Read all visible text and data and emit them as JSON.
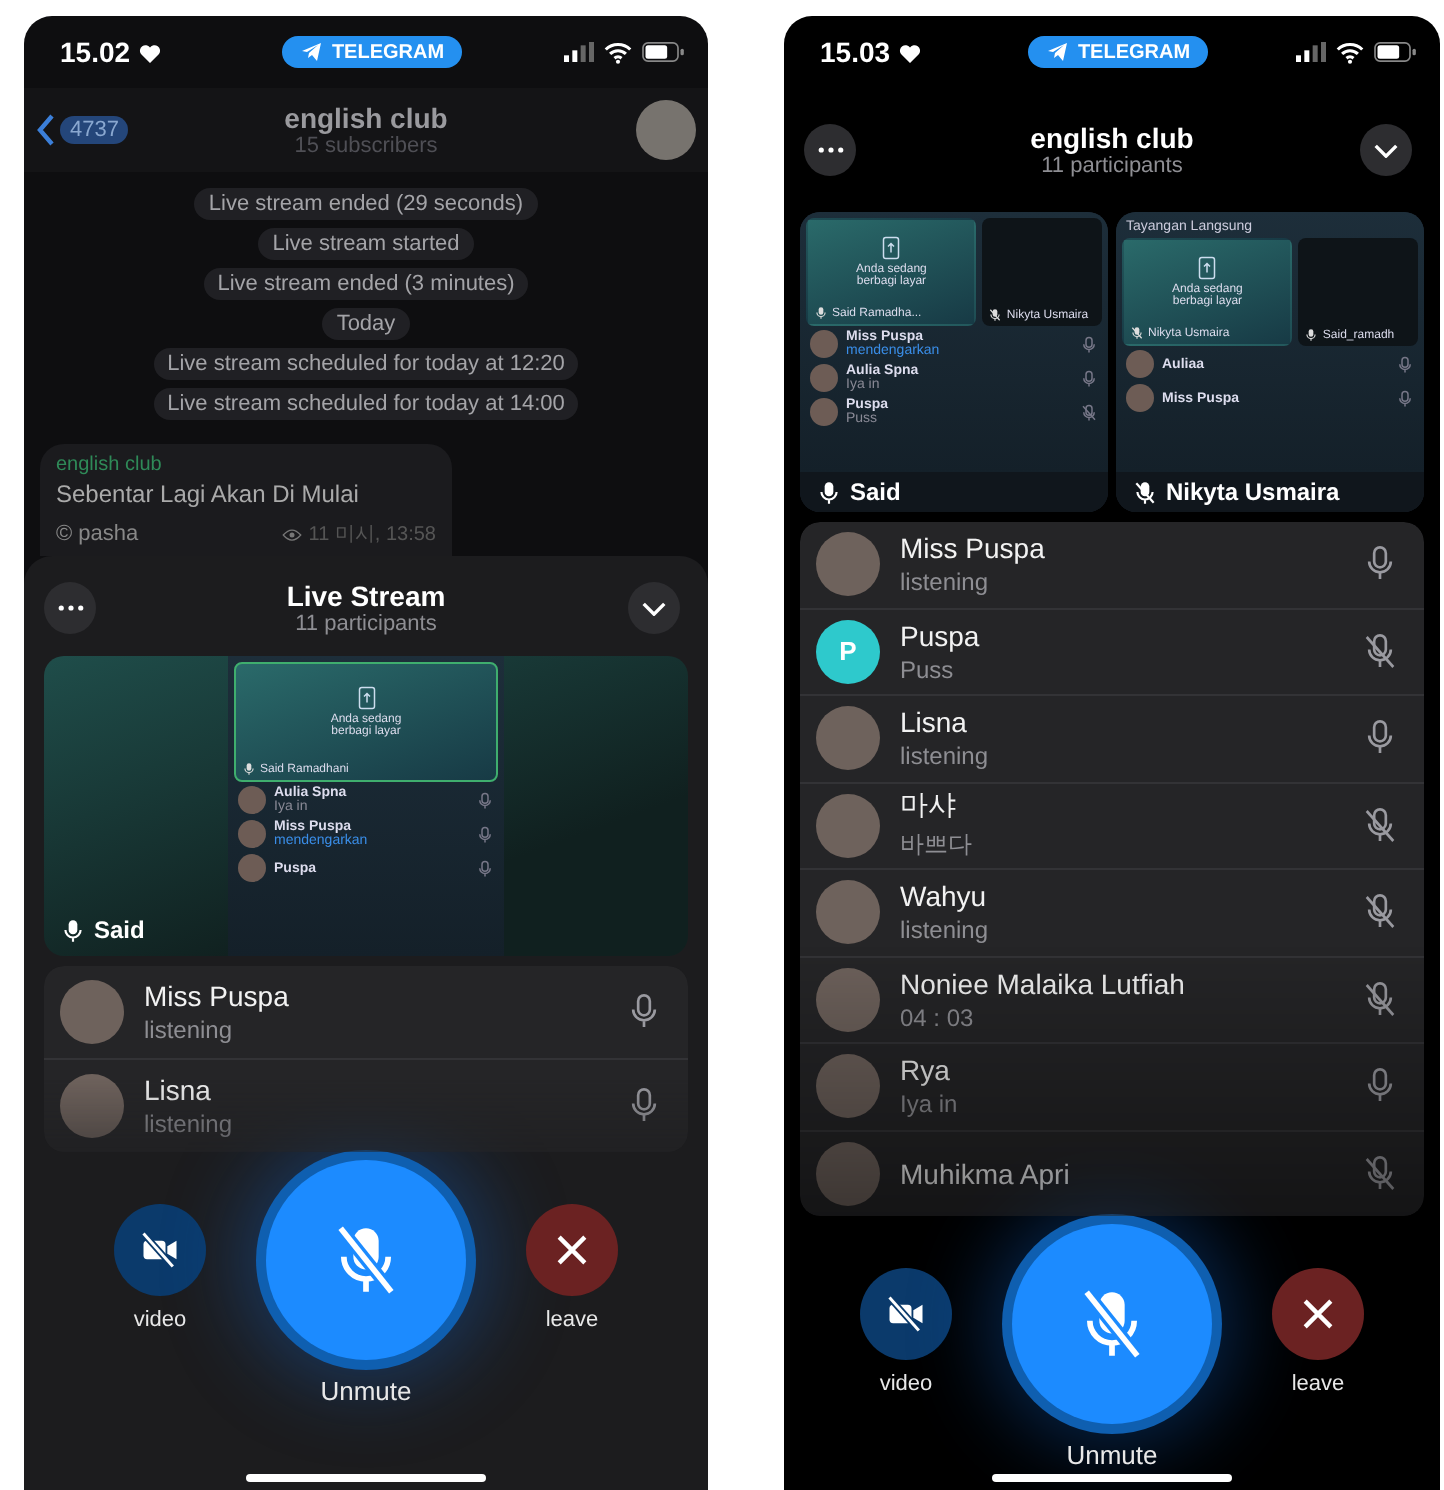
{
  "screens": [
    {
      "kind": "panel",
      "status_bar": {
        "time": "15.02",
        "app_pill": "TELEGRAM"
      },
      "chat": {
        "back_badge": "4737",
        "title": "english club",
        "subtitle": "15 subscribers",
        "service_messages": [
          "Live stream ended (29 seconds)",
          "Live stream started",
          "Live stream ended (3 minutes)",
          "Today",
          "Live stream scheduled for today at 12:20",
          "Live stream scheduled for today at 14:00"
        ],
        "post": {
          "author": "english club",
          "text": "Sebentar Lagi Akan Di Mulai",
          "signature": "© pasha",
          "meta": "11 미시, 13:58"
        }
      },
      "call": {
        "title": "Live Stream",
        "subtitle": "11 participants",
        "tiles": [
          {
            "kind": "centered",
            "label": "Said",
            "muted": false,
            "screen": {
              "cards": [
                {
                  "notice": "Anda sedang berbagi layar",
                  "name": "Said Ramadhani",
                  "muted": false
                }
              ],
              "rows": [
                {
                  "name": "Aulia Spna",
                  "status": "Iya in",
                  "highlighted": false,
                  "muted": false
                },
                {
                  "name": "Miss Puspa",
                  "status": "mendengarkan",
                  "highlighted": true,
                  "muted": false
                },
                {
                  "name": "Puspa",
                  "muted": false
                }
              ]
            }
          }
        ],
        "participants": [
          {
            "name": "Miss Puspa",
            "status": "listening",
            "muted": false,
            "avatar": {
              "kind": "photo"
            }
          },
          {
            "name": "Lisna",
            "status": "listening",
            "muted": false,
            "avatar": {
              "kind": "photo"
            }
          }
        ],
        "controls": [
          {
            "kind": "video",
            "label": "video"
          },
          {
            "kind": "mute",
            "label": "Unmute"
          },
          {
            "kind": "leave",
            "label": "leave"
          }
        ]
      }
    },
    {
      "kind": "fullscreen",
      "status_bar": {
        "time": "15.03",
        "app_pill": "TELEGRAM"
      },
      "call": {
        "title": "english club",
        "subtitle": "11 participants",
        "tiles": [
          {
            "kind": "fill",
            "label": "Said",
            "muted": false,
            "screen": {
              "cards": [
                {
                  "notice": "Anda sedang berbagi layar",
                  "name": "Said Ramadha...",
                  "muted": false
                },
                {
                  "name": "Nikyta Usmaira",
                  "muted": true
                }
              ],
              "rows": [
                {
                  "name": "Miss Puspa",
                  "status": "mendengarkan",
                  "highlighted": true,
                  "muted": false
                },
                {
                  "name": "Aulia Spna",
                  "status": "Iya in",
                  "highlighted": false,
                  "muted": false
                },
                {
                  "name": "Puspa",
                  "status": "Puss",
                  "highlighted": false,
                  "muted": true
                }
              ]
            }
          },
          {
            "kind": "fill",
            "label": "Nikyta Usmaira",
            "muted": true,
            "screen": {
              "title": "Tayangan Langsung",
              "cards": [
                {
                  "notice": "Anda sedang berbagi layar",
                  "name": "Nikyta Usmaira",
                  "muted": true
                },
                {
                  "name": "Said_ramadh",
                  "muted": false
                }
              ],
              "rows": [
                {
                  "name": "Auliaa",
                  "muted": false
                },
                {
                  "name": "Miss Puspa",
                  "muted": false
                }
              ]
            }
          }
        ],
        "participants": [
          {
            "name": "Miss Puspa",
            "status": "listening",
            "muted": false,
            "avatar": {
              "kind": "photo"
            }
          },
          {
            "name": "Puspa",
            "status": "Puss",
            "muted": true,
            "avatar": {
              "kind": "letter",
              "letter": "P",
              "color": "#2ec9cc"
            }
          },
          {
            "name": "Lisna",
            "status": "listening",
            "muted": false,
            "avatar": {
              "kind": "photo"
            }
          },
          {
            "name": "마샤",
            "status": "바쁘다",
            "muted": true,
            "avatar": {
              "kind": "photo"
            }
          },
          {
            "name": "Wahyu",
            "status": "listening",
            "muted": true,
            "avatar": {
              "kind": "photo"
            }
          },
          {
            "name": "Noniee Malaika Lutfiah",
            "status": "04 : 03",
            "muted": true,
            "avatar": {
              "kind": "photo"
            }
          },
          {
            "name": "Rya",
            "status": "Iya in",
            "muted": false,
            "avatar": {
              "kind": "photo"
            }
          },
          {
            "name": "Muhikma Apri",
            "muted": true,
            "avatar": {
              "kind": "photo"
            }
          }
        ],
        "controls": [
          {
            "kind": "video",
            "label": "video"
          },
          {
            "kind": "mute",
            "label": "Unmute"
          },
          {
            "kind": "leave",
            "label": "leave"
          }
        ]
      }
    }
  ]
}
